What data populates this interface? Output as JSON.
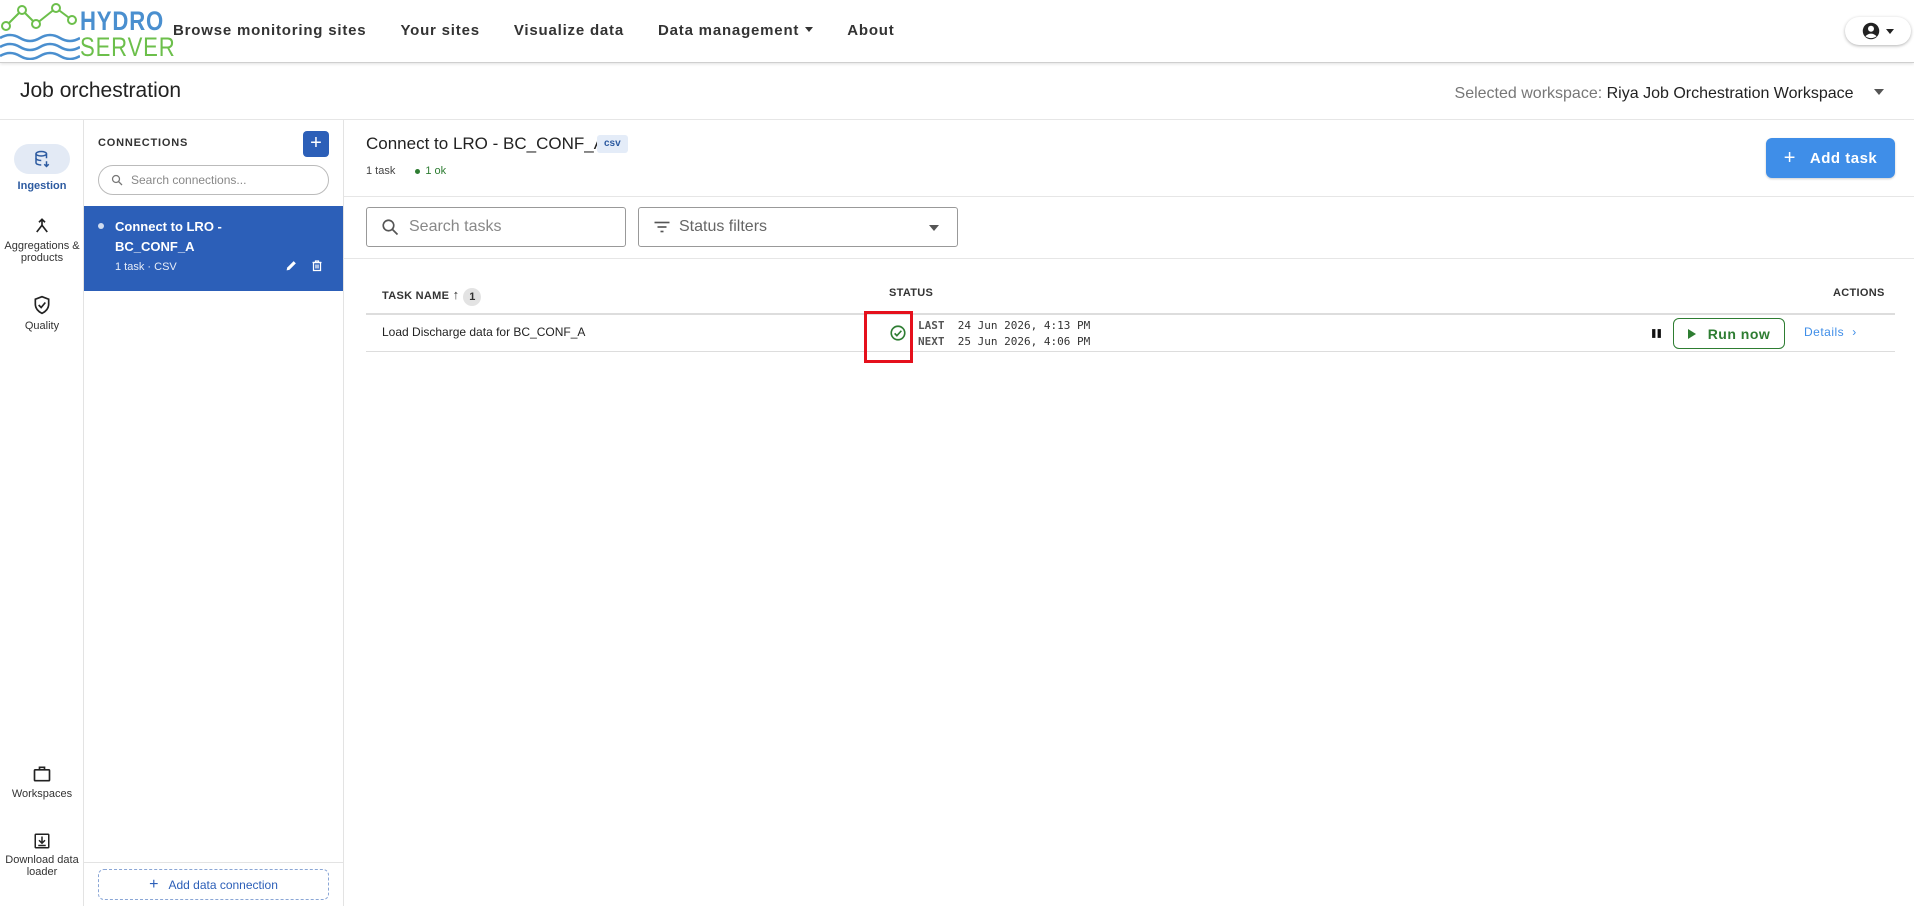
{
  "app": {
    "logo_line1": "HYDRO",
    "logo_line2": "SERVER"
  },
  "nav": {
    "items": [
      {
        "label": "Browse monitoring sites"
      },
      {
        "label": "Your sites"
      },
      {
        "label": "Visualize data"
      },
      {
        "label": "Data management"
      },
      {
        "label": "About"
      }
    ]
  },
  "page": {
    "title": "Job orchestration",
    "workspace_label": "Selected workspace:",
    "workspace_name": "Riya Job Orchestration Workspace"
  },
  "rail": {
    "items": [
      {
        "label": "Ingestion",
        "icon": "database-icon",
        "active": true
      },
      {
        "label": "Aggregations & products",
        "icon": "merge-icon"
      },
      {
        "label": "Quality",
        "icon": "shield-check-icon"
      },
      {
        "label": "Workspaces",
        "icon": "briefcase-icon"
      },
      {
        "label": "Download data loader",
        "icon": "download-box-icon"
      }
    ]
  },
  "connections": {
    "heading": "CONNECTIONS",
    "search_placeholder": "Search connections...",
    "items": [
      {
        "name": "Connect to LRO - BC_CONF_A",
        "meta": "1 task · CSV"
      }
    ],
    "add_label": "Add data connection"
  },
  "main": {
    "title": "Connect to LRO - BC_CONF_A",
    "badge": "csv",
    "task_count": "1 task",
    "ok_count": "1 ok",
    "add_task_label": "Add task",
    "search_placeholder": "Search tasks",
    "status_filter_label": "Status filters",
    "table": {
      "col_name": "TASK NAME",
      "sort_badge": "1",
      "col_status": "STATUS",
      "col_actions": "ACTIONS",
      "rows": [
        {
          "name": "Load Discharge data for BC_CONF_A",
          "status": "ok",
          "last_label": "LAST",
          "last_value": "24 Jun 2026, 4:13 PM",
          "next_label": "NEXT",
          "next_value": "25 Jun 2026, 4:06 PM",
          "run_label": "Run now",
          "details_label": "Details"
        }
      ]
    }
  },
  "colors": {
    "primary": "#2c5fb8",
    "accent": "#3f8ee8",
    "ok": "#2e7d32",
    "highlight": "#e5101c"
  }
}
